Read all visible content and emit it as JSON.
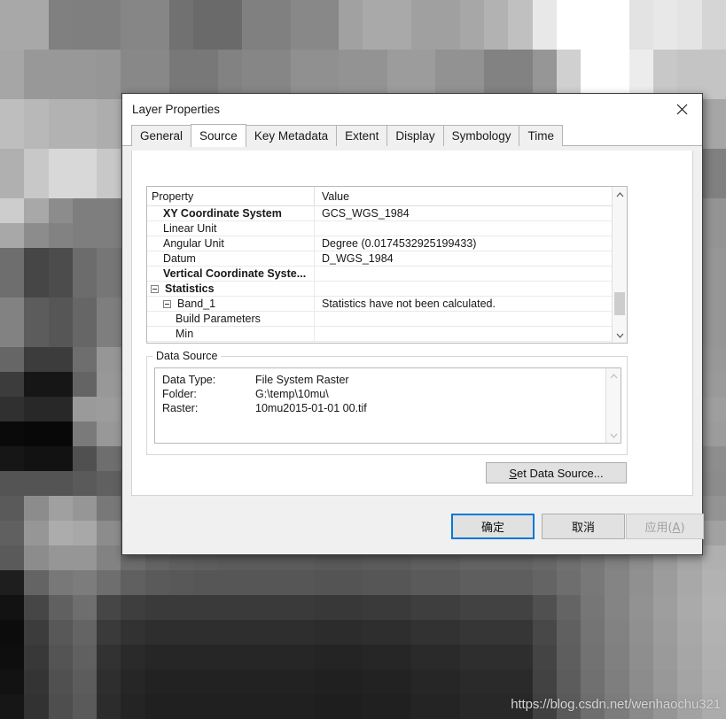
{
  "background": {
    "watermark": "https://blog.csdn.net/wenhaochu321",
    "cell_size": 28,
    "grid_cols": 30,
    "grid_rows": 29,
    "luminance_rows": [
      [
        168,
        168,
        128,
        127,
        127,
        134,
        134,
        113,
        106,
        106,
        128,
        128,
        136,
        136,
        161,
        169,
        169,
        160,
        160,
        167,
        178,
        192,
        232,
        255,
        255,
        255,
        227,
        232,
        228,
        213
      ],
      [
        168,
        168,
        128,
        127,
        127,
        134,
        134,
        113,
        106,
        106,
        128,
        128,
        136,
        136,
        161,
        169,
        169,
        160,
        160,
        167,
        178,
        192,
        232,
        255,
        255,
        255,
        227,
        232,
        228,
        213
      ],
      [
        166,
        152,
        152,
        152,
        150,
        136,
        136,
        120,
        120,
        130,
        134,
        134,
        144,
        144,
        147,
        147,
        156,
        156,
        146,
        146,
        130,
        130,
        150,
        208,
        255,
        255,
        236,
        200,
        196,
        196
      ],
      [
        166,
        152,
        152,
        152,
        150,
        136,
        136,
        120,
        120,
        130,
        134,
        134,
        144,
        144,
        147,
        147,
        156,
        156,
        146,
        146,
        130,
        130,
        150,
        208,
        255,
        255,
        236,
        200,
        196,
        196
      ],
      [
        190,
        184,
        178,
        178,
        173,
        166,
        160,
        146,
        146,
        140,
        140,
        152,
        152,
        150,
        150,
        148,
        148,
        140,
        140,
        132,
        132,
        170,
        176,
        226,
        220,
        206,
        136,
        136,
        152,
        166
      ],
      [
        190,
        184,
        178,
        178,
        173,
        166,
        160,
        146,
        146,
        140,
        140,
        152,
        152,
        150,
        150,
        148,
        148,
        140,
        140,
        132,
        132,
        170,
        176,
        226,
        220,
        206,
        136,
        136,
        152,
        166
      ],
      [
        176,
        200,
        216,
        216,
        200,
        176,
        168,
        144,
        144,
        150,
        150,
        166,
        166,
        166,
        166,
        166,
        166,
        156,
        156,
        152,
        152,
        168,
        120,
        108,
        96,
        88,
        84,
        92,
        110,
        128
      ],
      [
        176,
        200,
        216,
        216,
        200,
        176,
        168,
        144,
        144,
        150,
        150,
        166,
        166,
        166,
        166,
        166,
        166,
        156,
        156,
        152,
        152,
        168,
        120,
        108,
        96,
        88,
        84,
        92,
        110,
        128
      ],
      [
        205,
        168,
        140,
        126,
        126,
        130,
        130,
        130,
        130,
        140,
        140,
        130,
        130,
        120,
        120,
        120,
        128,
        128,
        132,
        132,
        140,
        140,
        104,
        96,
        88,
        92,
        104,
        116,
        132,
        148
      ],
      [
        168,
        140,
        130,
        126,
        126,
        130,
        130,
        130,
        130,
        140,
        140,
        130,
        130,
        120,
        120,
        120,
        128,
        128,
        132,
        132,
        140,
        140,
        104,
        96,
        88,
        92,
        104,
        116,
        132,
        148
      ],
      [
        110,
        70,
        76,
        108,
        118,
        112,
        112,
        112,
        112,
        118,
        118,
        120,
        120,
        116,
        116,
        112,
        112,
        116,
        116,
        120,
        120,
        120,
        110,
        100,
        96,
        100,
        112,
        126,
        140,
        150
      ],
      [
        110,
        70,
        76,
        108,
        118,
        112,
        112,
        112,
        112,
        118,
        118,
        120,
        120,
        116,
        116,
        112,
        112,
        116,
        116,
        120,
        120,
        120,
        110,
        100,
        96,
        100,
        112,
        126,
        140,
        150
      ],
      [
        130,
        92,
        86,
        102,
        126,
        124,
        124,
        124,
        124,
        120,
        120,
        118,
        118,
        116,
        116,
        118,
        118,
        120,
        120,
        122,
        122,
        122,
        112,
        104,
        100,
        104,
        114,
        128,
        140,
        150
      ],
      [
        130,
        92,
        86,
        102,
        126,
        124,
        124,
        124,
        124,
        120,
        120,
        118,
        118,
        116,
        116,
        118,
        118,
        120,
        120,
        122,
        122,
        122,
        112,
        104,
        100,
        104,
        114,
        128,
        140,
        150
      ],
      [
        102,
        60,
        60,
        110,
        150,
        140,
        140,
        130,
        130,
        124,
        124,
        120,
        120,
        118,
        118,
        120,
        120,
        124,
        124,
        128,
        128,
        128,
        116,
        108,
        104,
        108,
        118,
        130,
        142,
        152
      ],
      [
        60,
        22,
        22,
        100,
        152,
        146,
        146,
        136,
        136,
        128,
        128,
        122,
        122,
        120,
        120,
        122,
        122,
        126,
        126,
        130,
        130,
        130,
        118,
        110,
        106,
        110,
        120,
        132,
        144,
        154
      ],
      [
        48,
        40,
        40,
        154,
        156,
        150,
        150,
        140,
        140,
        132,
        132,
        126,
        126,
        124,
        124,
        126,
        126,
        130,
        130,
        134,
        134,
        134,
        122,
        114,
        110,
        114,
        124,
        136,
        148,
        158
      ],
      [
        10,
        8,
        8,
        122,
        152,
        148,
        148,
        138,
        138,
        130,
        130,
        124,
        124,
        122,
        122,
        124,
        124,
        128,
        128,
        132,
        132,
        132,
        120,
        112,
        108,
        112,
        122,
        134,
        146,
        156
      ],
      [
        22,
        18,
        18,
        80,
        110,
        108,
        108,
        104,
        104,
        102,
        102,
        100,
        100,
        98,
        98,
        100,
        100,
        104,
        104,
        108,
        108,
        108,
        100,
        96,
        94,
        98,
        108,
        120,
        132,
        142
      ],
      [
        84,
        84,
        84,
        90,
        96,
        94,
        94,
        92,
        92,
        90,
        90,
        90,
        90,
        88,
        88,
        90,
        90,
        94,
        94,
        98,
        98,
        98,
        94,
        92,
        92,
        96,
        106,
        118,
        130,
        140
      ],
      [
        90,
        140,
        160,
        150,
        120,
        100,
        96,
        94,
        92,
        90,
        90,
        90,
        90,
        88,
        88,
        90,
        90,
        94,
        94,
        98,
        98,
        98,
        96,
        96,
        98,
        104,
        114,
        126,
        138,
        148
      ],
      [
        96,
        150,
        172,
        168,
        140,
        110,
        100,
        96,
        94,
        92,
        92,
        92,
        92,
        90,
        90,
        92,
        92,
        96,
        96,
        100,
        100,
        100,
        100,
        104,
        110,
        118,
        128,
        140,
        152,
        162
      ],
      [
        90,
        140,
        150,
        150,
        130,
        108,
        100,
        96,
        94,
        92,
        92,
        92,
        92,
        90,
        90,
        92,
        92,
        96,
        96,
        100,
        100,
        100,
        104,
        112,
        120,
        130,
        142,
        154,
        166,
        176
      ],
      [
        30,
        100,
        120,
        124,
        110,
        96,
        90,
        88,
        86,
        86,
        86,
        86,
        86,
        84,
        84,
        86,
        86,
        90,
        90,
        94,
        94,
        94,
        100,
        110,
        120,
        132,
        144,
        156,
        168,
        178
      ],
      [
        18,
        70,
        96,
        110,
        70,
        62,
        58,
        58,
        58,
        58,
        58,
        58,
        58,
        56,
        56,
        58,
        58,
        62,
        62,
        66,
        66,
        66,
        80,
        100,
        118,
        132,
        146,
        158,
        170,
        180
      ],
      [
        12,
        60,
        88,
        100,
        58,
        50,
        46,
        46,
        46,
        46,
        46,
        46,
        46,
        44,
        44,
        46,
        46,
        50,
        50,
        54,
        54,
        54,
        72,
        96,
        116,
        130,
        144,
        156,
        168,
        178
      ],
      [
        14,
        56,
        84,
        96,
        50,
        42,
        38,
        38,
        38,
        38,
        38,
        38,
        38,
        36,
        36,
        38,
        38,
        42,
        42,
        46,
        46,
        46,
        68,
        94,
        114,
        128,
        142,
        154,
        166,
        176
      ],
      [
        18,
        52,
        80,
        92,
        46,
        38,
        34,
        34,
        34,
        34,
        34,
        34,
        34,
        32,
        32,
        34,
        34,
        38,
        38,
        42,
        42,
        42,
        66,
        92,
        112,
        126,
        140,
        152,
        164,
        174
      ],
      [
        22,
        50,
        78,
        90,
        44,
        36,
        32,
        32,
        32,
        32,
        32,
        32,
        32,
        30,
        30,
        32,
        32,
        36,
        36,
        40,
        40,
        40,
        64,
        90,
        110,
        124,
        138,
        150,
        162,
        172
      ]
    ]
  },
  "dialog": {
    "title": "Layer Properties",
    "close_icon": "close-icon",
    "tabs": [
      {
        "label": "General",
        "active": false
      },
      {
        "label": "Source",
        "active": true
      },
      {
        "label": "Key Metadata",
        "active": false
      },
      {
        "label": "Extent",
        "active": false
      },
      {
        "label": "Display",
        "active": false
      },
      {
        "label": "Symbology",
        "active": false
      },
      {
        "label": "Time",
        "active": false
      }
    ],
    "property_grid": {
      "columns": [
        "Property",
        "Value"
      ],
      "rows": [
        {
          "indent": 1,
          "expander": "none",
          "bold": true,
          "property": "XY Coordinate System",
          "value": "GCS_WGS_1984"
        },
        {
          "indent": 1,
          "expander": "none",
          "bold": false,
          "property": "Linear Unit",
          "value": ""
        },
        {
          "indent": 1,
          "expander": "none",
          "bold": false,
          "property": "Angular Unit",
          "value": "Degree (0.0174532925199433)"
        },
        {
          "indent": 1,
          "expander": "none",
          "bold": false,
          "property": "Datum",
          "value": "D_WGS_1984"
        },
        {
          "indent": 1,
          "expander": "none",
          "bold": true,
          "property": "Vertical Coordinate Syste...",
          "value": ""
        },
        {
          "indent": 0,
          "expander": "minus",
          "bold": true,
          "property": "Statistics",
          "value": ""
        },
        {
          "indent": 1,
          "expander": "minus",
          "bold": false,
          "property": "Band_1",
          "value": "Statistics have not been calculated."
        },
        {
          "indent": 2,
          "expander": "none",
          "bold": false,
          "property": "Build Parameters",
          "value": ""
        },
        {
          "indent": 2,
          "expander": "none",
          "bold": false,
          "property": "Min",
          "value": ""
        }
      ],
      "scrollbar": {
        "up_arrow": "chevron-up-icon",
        "down_arrow": "chevron-down-icon",
        "thumb_top_pct": 58,
        "thumb_height_pct": 15
      }
    },
    "data_source": {
      "legend": "Data Source",
      "lines": [
        {
          "key": "Data Type:",
          "value": "File System Raster"
        },
        {
          "key": "Folder:",
          "value": "G:\\temp\\10mu\\"
        },
        {
          "key": "Raster:",
          "value": "10mu2015-01-01 00.tif"
        }
      ],
      "scrollbar": {
        "up_arrow": "chevron-up-icon",
        "down_arrow": "chevron-down-icon"
      },
      "set_data_source_button": {
        "mnemonic": "S",
        "rest": "et Data Source..."
      }
    },
    "footer": {
      "ok_label": "确定",
      "cancel_label": "取消",
      "apply_label": "应用(",
      "apply_mnemonic": "A",
      "apply_suffix": ")",
      "apply_disabled": true,
      "default_button": "ok"
    }
  },
  "colors": {
    "accent": "#0078d7",
    "dialog_bg": "#f0f0f0",
    "panel_bg": "#ffffff",
    "button_bg": "#e1e1e1",
    "border": "#b9b9b9",
    "text": "#171717",
    "disabled_text": "#a0a0a0"
  }
}
